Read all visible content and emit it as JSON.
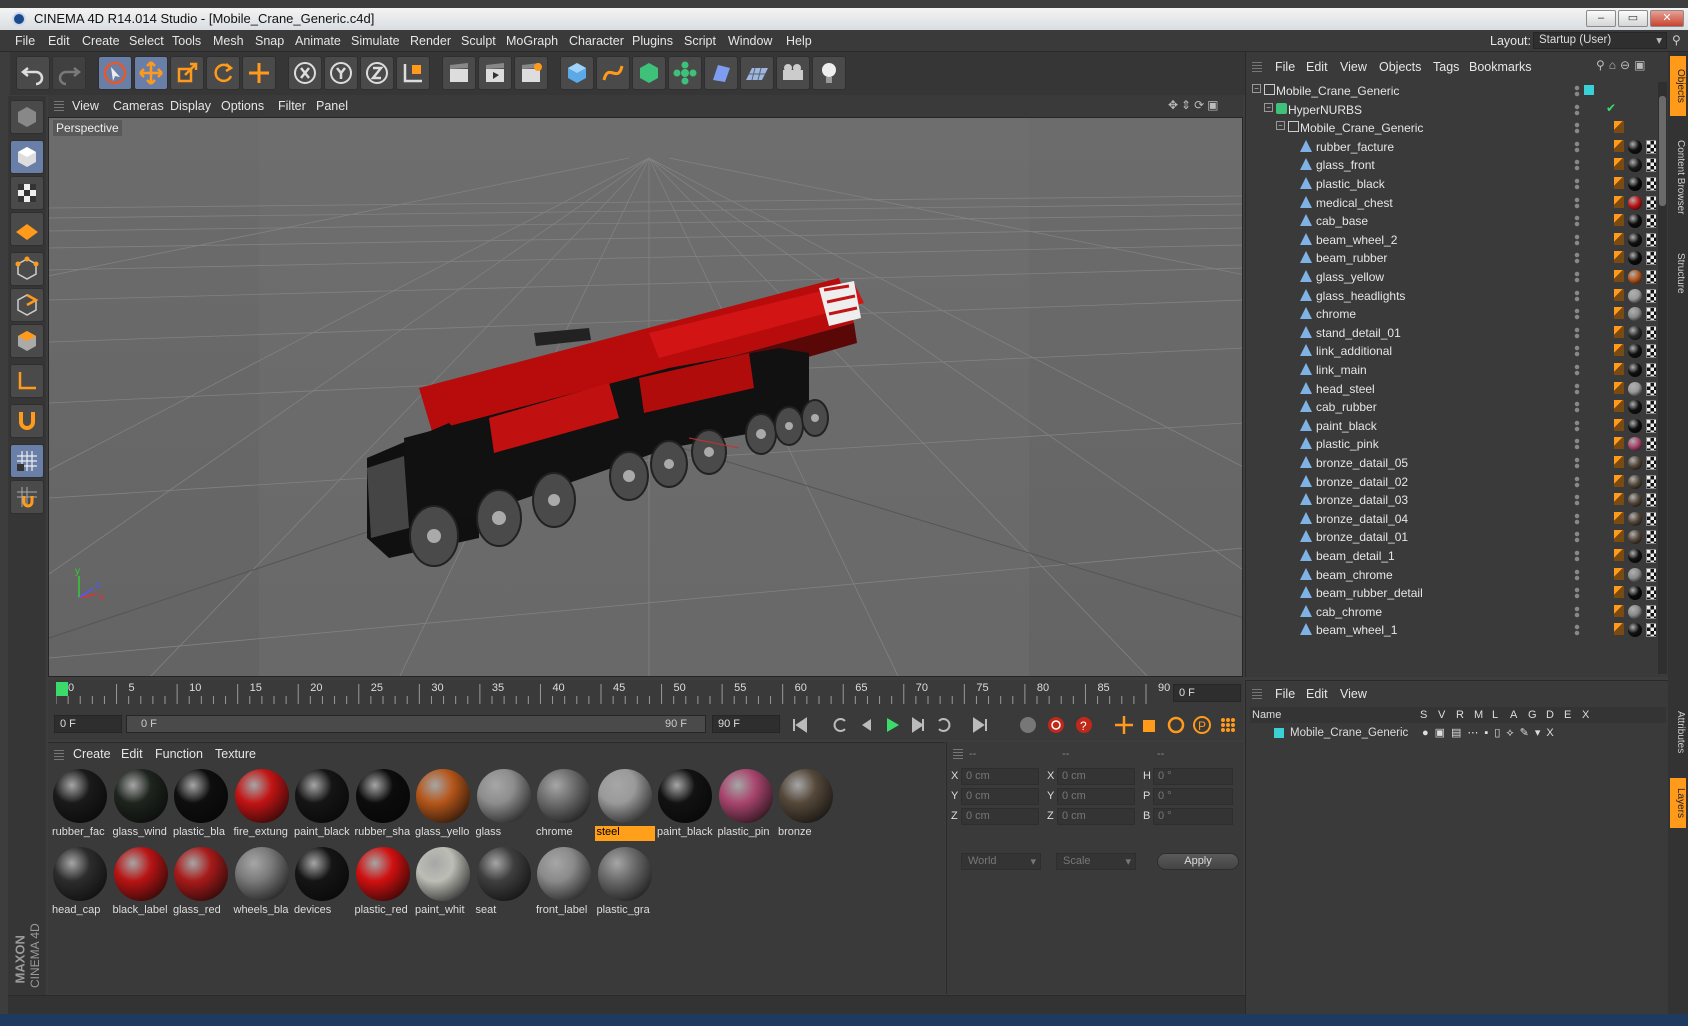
{
  "window": {
    "title": "CINEMA 4D R14.014 Studio - [Mobile_Crane_Generic.c4d]",
    "minimize": "–",
    "restore": "▭",
    "close": "✕"
  },
  "menubar": {
    "items": [
      "File",
      "Edit",
      "Create",
      "Select",
      "Tools",
      "Mesh",
      "Snap",
      "Animate",
      "Simulate",
      "Render",
      "Sculpt",
      "MoGraph",
      "Character",
      "Plugins",
      "Script",
      "Window",
      "Help"
    ],
    "layout_label": "Layout:",
    "layout_value": "Startup (User)"
  },
  "viewport": {
    "menu": [
      "View",
      "Cameras",
      "Display",
      "Options",
      "Filter",
      "Panel"
    ],
    "label": "Perspective",
    "axis_x": "x",
    "axis_y": "y",
    "axis_z": "z"
  },
  "timeline": {
    "ticks": [
      "0",
      "5",
      "10",
      "15",
      "20",
      "25",
      "30",
      "35",
      "40",
      "45",
      "50",
      "55",
      "60",
      "65",
      "70",
      "75",
      "80",
      "85",
      "90"
    ],
    "current_frame": "0 F"
  },
  "transport": {
    "start": "0 F",
    "range_left": "0 F",
    "range_right": "90 F",
    "end": "90 F"
  },
  "material_manager": {
    "menu": [
      "Create",
      "Edit",
      "Function",
      "Texture"
    ],
    "materials": [
      {
        "name": "rubber_fac",
        "color": "#1a1a1a"
      },
      {
        "name": "glass_wind",
        "color": "#1e241e"
      },
      {
        "name": "plastic_bla",
        "color": "#0e0e0e"
      },
      {
        "name": "fire_extung",
        "color": "#c21414"
      },
      {
        "name": "paint_black",
        "color": "#151515"
      },
      {
        "name": "rubber_sha",
        "color": "#0c0c0c"
      },
      {
        "name": "glass_yello",
        "color": "#b5561a"
      },
      {
        "name": "glass",
        "color": "#8d8d8d"
      },
      {
        "name": "chrome",
        "color": "#6e6e6e"
      },
      {
        "name": "steel",
        "color": "#9a9a9a",
        "active": true
      },
      {
        "name": "paint_black",
        "color": "#121212"
      },
      {
        "name": "plastic_pin",
        "color": "#a8456e"
      },
      {
        "name": "bronze",
        "color": "#55483a"
      },
      {
        "name": "head_cap",
        "color": "#2c2c2c"
      },
      {
        "name": "black_label",
        "color": "#b81414"
      },
      {
        "name": "glass_red",
        "color": "#a81a1a"
      },
      {
        "name": "wheels_bla",
        "color": "#7a7a7a"
      },
      {
        "name": "devices",
        "color": "#151515"
      },
      {
        "name": "plastic_red",
        "color": "#d01010"
      },
      {
        "name": "paint_whit",
        "color": "#bdbdb6"
      },
      {
        "name": "seat",
        "color": "#3e3e3e"
      },
      {
        "name": "front_label",
        "color": "#8a8a8a"
      },
      {
        "name": "plastic_gra",
        "color": "#6a6a6a"
      }
    ]
  },
  "coordinates": {
    "head1": "--",
    "head2": "--",
    "head3": "--",
    "rows": [
      {
        "a": "X",
        "v1": "0 cm",
        "b": "X",
        "v2": "0 cm",
        "c": "H",
        "v3": "0 °"
      },
      {
        "a": "Y",
        "v1": "0 cm",
        "b": "Y",
        "v2": "0 cm",
        "c": "P",
        "v3": "0 °"
      },
      {
        "a": "Z",
        "v1": "0 cm",
        "b": "Z",
        "v2": "0 cm",
        "c": "B",
        "v3": "0 °"
      }
    ],
    "world": "World",
    "scale": "Scale",
    "apply": "Apply"
  },
  "object_manager": {
    "menu": [
      "File",
      "Edit",
      "View",
      "Objects",
      "Tags",
      "Bookmarks"
    ],
    "root": "Mobile_Crane_Generic",
    "hypernurbs": "HyperNURBS",
    "group": "Mobile_Crane_Generic",
    "objects": [
      {
        "name": "rubber_facture",
        "tag": "#111111"
      },
      {
        "name": "glass_front",
        "tag": "#1a1a1a"
      },
      {
        "name": "plastic_black",
        "tag": "#0a0a0a"
      },
      {
        "name": "medical_chest",
        "tag": "#c21414"
      },
      {
        "name": "cab_base",
        "tag": "#0d0d0d"
      },
      {
        "name": "beam_wheel_2",
        "tag": "#111111"
      },
      {
        "name": "beam_rubber",
        "tag": "#0b0b0b"
      },
      {
        "name": "glass_yellow",
        "tag": "#b5561a"
      },
      {
        "name": "glass_headlights",
        "tag": "#9a9a9a"
      },
      {
        "name": "chrome",
        "tag": "#8a8a8a"
      },
      {
        "name": "stand_detail_01",
        "tag": "#2a2a2a"
      },
      {
        "name": "link_additional",
        "tag": "#111111"
      },
      {
        "name": "link_main",
        "tag": "#0f0f0f"
      },
      {
        "name": "head_steel",
        "tag": "#9a9a9a"
      },
      {
        "name": "cab_rubber",
        "tag": "#111111"
      },
      {
        "name": "paint_black",
        "tag": "#0d0d0d"
      },
      {
        "name": "plastic_pink",
        "tag": "#a8456e"
      },
      {
        "name": "bronze_datail_05",
        "tag": "#55483a"
      },
      {
        "name": "bronze_datail_02",
        "tag": "#55483a"
      },
      {
        "name": "bronze_datail_03",
        "tag": "#55483a"
      },
      {
        "name": "bronze_datail_04",
        "tag": "#55483a"
      },
      {
        "name": "bronze_datail_01",
        "tag": "#55483a"
      },
      {
        "name": "beam_detail_1",
        "tag": "#111111"
      },
      {
        "name": "beam_chrome",
        "tag": "#8a8a8a"
      },
      {
        "name": "beam_rubber_detail",
        "tag": "#0b0b0b"
      },
      {
        "name": "cab_chrome",
        "tag": "#8a8a8a"
      },
      {
        "name": "beam_wheel_1",
        "tag": "#111111"
      }
    ]
  },
  "layers": {
    "menu": [
      "File",
      "Edit",
      "View"
    ],
    "cols": [
      "Name",
      "S",
      "V",
      "R",
      "M",
      "L",
      "A",
      "G",
      "D",
      "E",
      "X"
    ],
    "layer_name": "Mobile_Crane_Generic"
  },
  "right_tabs": [
    "Objects",
    "Content Browser",
    "Structure",
    "Attributes",
    "Layers"
  ],
  "brand": {
    "maxon": "MAXON",
    "cinema": "CINEMA 4D"
  },
  "colors": {
    "accent": "#6a7fa8",
    "active": "#ff9f1a",
    "crane_red": "#b80c0c"
  }
}
